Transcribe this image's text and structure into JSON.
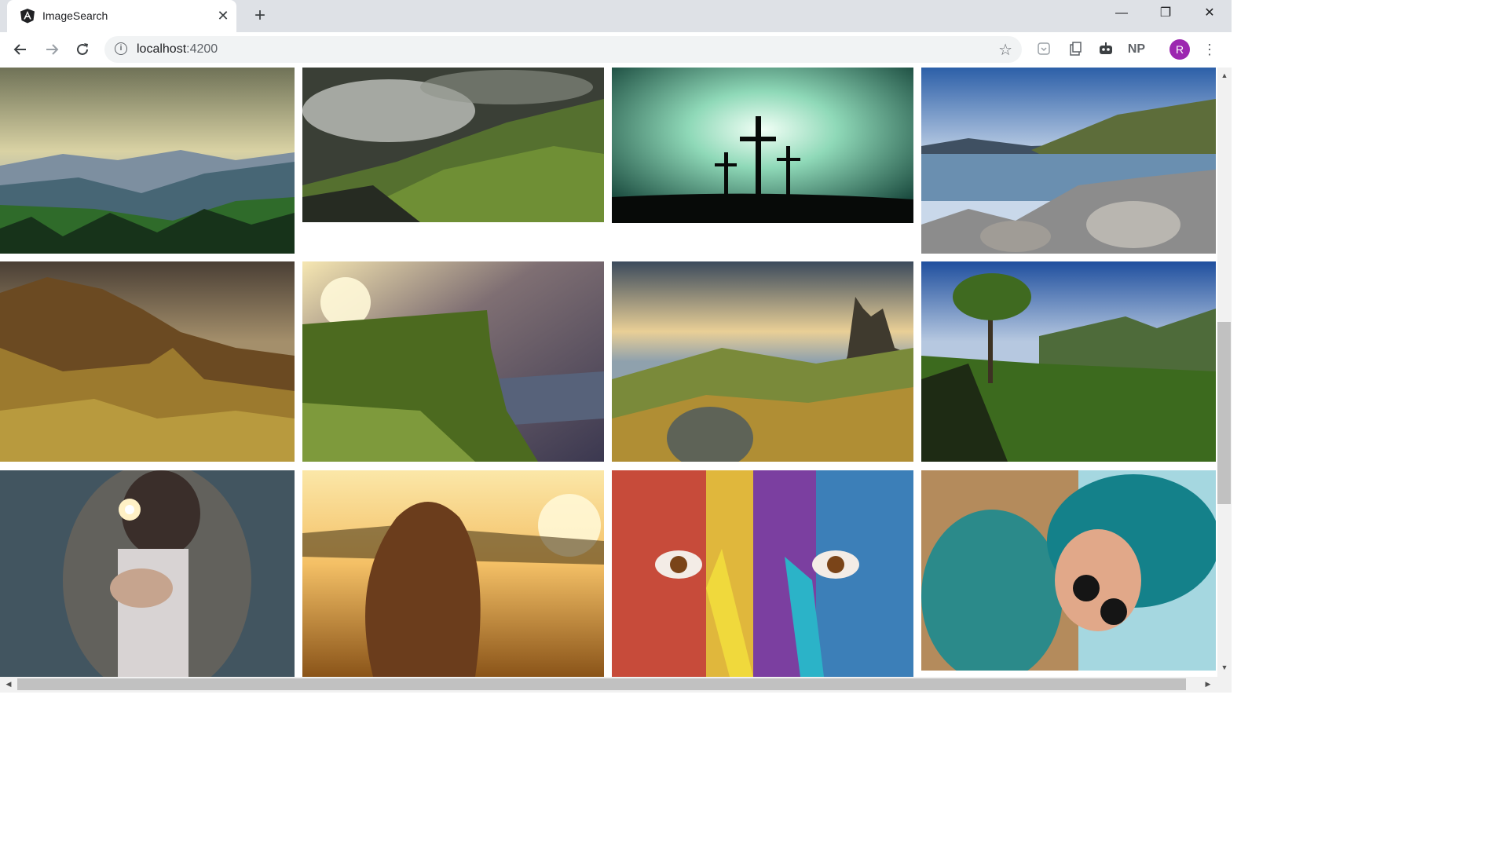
{
  "browser": {
    "tab": {
      "title": "ImageSearch",
      "favicon": "angular-logo-icon",
      "close_label": "✕"
    },
    "new_tab_label": "+",
    "window_controls": {
      "minimize": "—",
      "maximize": "❐",
      "close": "✕"
    },
    "address": {
      "host": "localhost",
      "port": ":4200"
    },
    "profile_initial": "R",
    "extensions": [
      "pocket-icon",
      "notes-icon",
      "robot-icon",
      "np-extension"
    ],
    "extension_np_label": "NP",
    "accent_color": "#9c27b0"
  },
  "gallery": {
    "images": [
      {
        "subject": "mountain valley with forest under golden clouds"
      },
      {
        "subject": "misty green hills with cabins"
      },
      {
        "subject": "three crosses silhouetted against glowing sky"
      },
      {
        "subject": "rocky shoreline with lake and cliff"
      },
      {
        "subject": "golden brown hills under dramatic sky"
      },
      {
        "subject": "grassy cliff at sunset with two people"
      },
      {
        "subject": "rock pinnacles over green highland valley"
      },
      {
        "subject": "tree on green highland cliffs with lake"
      },
      {
        "subject": "woman holding sparkler"
      },
      {
        "subject": "woman with long hair in golden field at sunset"
      },
      {
        "subject": "face painted with colorful paint"
      },
      {
        "subject": "woman with teal hair and sunglasses by pool"
      }
    ]
  }
}
